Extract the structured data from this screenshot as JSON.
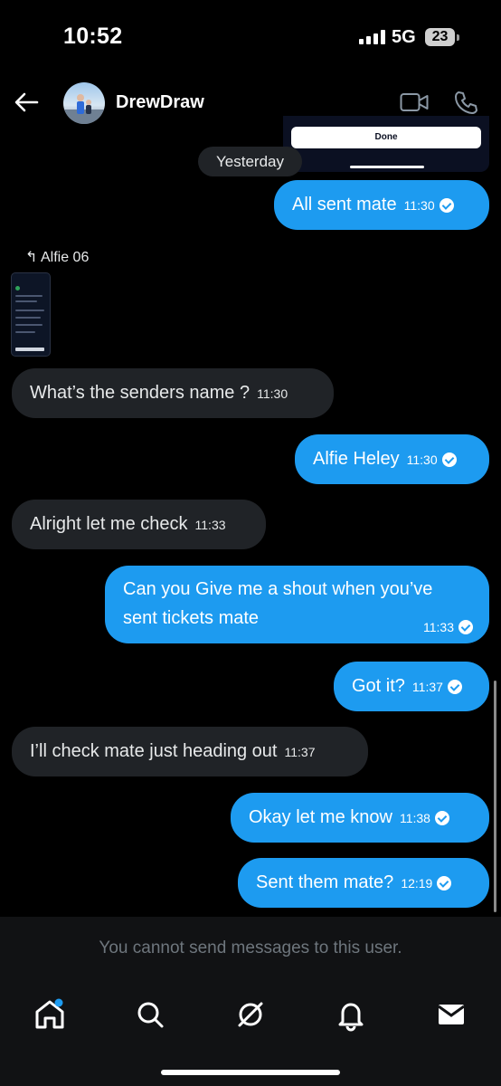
{
  "status_bar": {
    "time": "10:52",
    "network": "5G",
    "battery": "23"
  },
  "header": {
    "contact_name": "DrewDraw"
  },
  "media_peek": {
    "button_label": "Done"
  },
  "date_separator": "Yesterday",
  "reply": {
    "label": "Alfie 06"
  },
  "messages": [
    {
      "text": "All sent mate",
      "time": "11:30",
      "direction": "out"
    },
    {
      "text": "What’s the senders name ?",
      "time": "11:30",
      "direction": "in"
    },
    {
      "text": "Alfie Heley",
      "time": "11:30",
      "direction": "out"
    },
    {
      "text": "Alright let me check",
      "time": "11:33",
      "direction": "in"
    },
    {
      "text": "Can you Give me a shout when you’ve sent tickets mate",
      "time": "11:33",
      "direction": "out"
    },
    {
      "text": "Got it?",
      "time": "11:37",
      "direction": "out"
    },
    {
      "text": "I’ll check mate just heading out",
      "time": "11:37",
      "direction": "in"
    },
    {
      "text": "Okay let me know",
      "time": "11:38",
      "direction": "out"
    },
    {
      "text": "Sent them mate?",
      "time": "12:19",
      "direction": "out"
    }
  ],
  "footer": {
    "notice": "You cannot send messages to this user."
  },
  "bottom_nav": [
    {
      "icon": "home-icon",
      "has_badge": true
    },
    {
      "icon": "search-icon"
    },
    {
      "icon": "grok-icon"
    },
    {
      "icon": "bell-icon"
    },
    {
      "icon": "mail-icon"
    }
  ],
  "colors": {
    "outgoing_bubble": "#1d9bf0",
    "incoming_bubble": "#202327",
    "background": "#000000"
  }
}
